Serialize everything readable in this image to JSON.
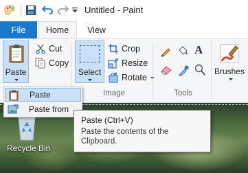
{
  "window": {
    "title": "Untitled - Paint"
  },
  "qat": {
    "icons": [
      "paint-app-icon",
      "save-icon",
      "undo-icon",
      "redo-icon",
      "customize-dropdown-icon"
    ]
  },
  "tabs": {
    "file": "File",
    "home": "Home",
    "view": "View"
  },
  "ribbon": {
    "clipboard": {
      "paste_label": "Paste",
      "cut_label": "Cut",
      "copy_label": "Copy"
    },
    "image": {
      "select_label": "Select",
      "crop_label": "Crop",
      "resize_label": "Resize",
      "rotate_label": "Rotate",
      "group_label": "Image"
    },
    "tools": {
      "group_label": "Tools"
    },
    "brushes": {
      "label": "Brushes"
    }
  },
  "paste_menu": {
    "items": [
      {
        "label": "Paste",
        "icon": "clipboard-icon"
      },
      {
        "label": "Paste from",
        "icon": "paste-from-icon"
      }
    ]
  },
  "tooltip": {
    "title": "Paste (Ctrl+V)",
    "body": "Paste the contents of the Clipboard."
  },
  "desktop": {
    "recycle_bin_label": "Recycle Bin"
  },
  "colors": {
    "file_tab": "#1979ca",
    "selected_button": "#c9e0f7",
    "selected_border": "#8cb8e6"
  }
}
